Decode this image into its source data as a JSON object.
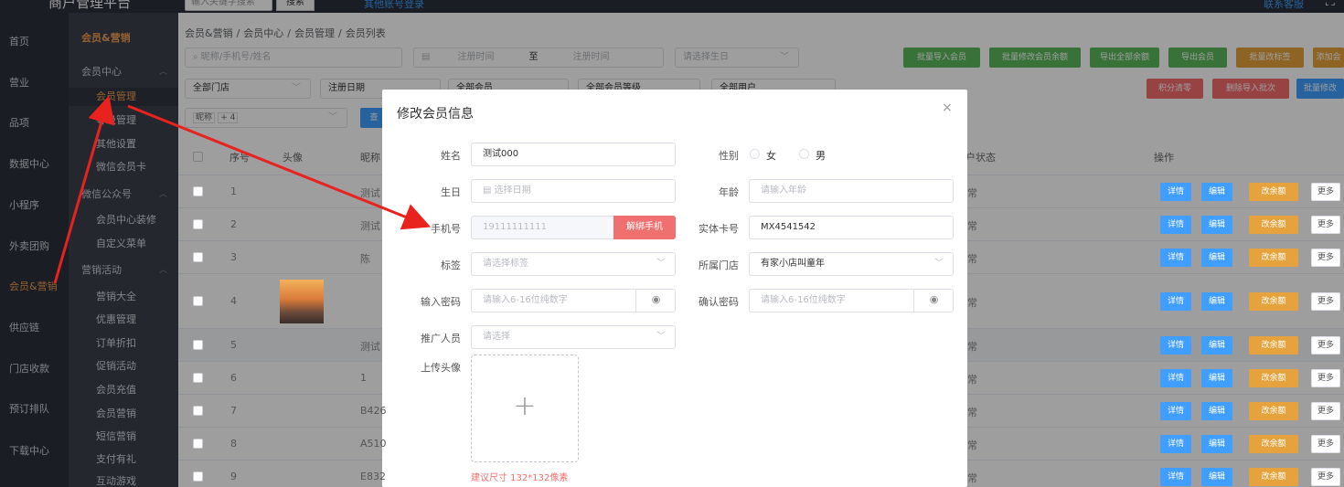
{
  "brand": "商户管理平台",
  "topbar": {
    "search_placeholder": "输入关键字搜索",
    "search_button": "搜索",
    "other_login": "其他账号登录",
    "service": "联系客服",
    "fullscreen_icon": "expand-icon"
  },
  "leftnav": [
    {
      "label": "首页"
    },
    {
      "label": "营业"
    },
    {
      "label": "品项"
    },
    {
      "label": "数据中心"
    },
    {
      "label": "小程序"
    },
    {
      "label": "外卖团购"
    },
    {
      "label": "会员&营销"
    },
    {
      "label": "供应链"
    },
    {
      "label": "门店收款"
    },
    {
      "label": "预订排队"
    },
    {
      "label": "下载中心"
    }
  ],
  "subnav": {
    "title": "会员&营销",
    "items": [
      {
        "label": "会员中心",
        "kind": "group"
      },
      {
        "label": "会员管理",
        "kind": "link"
      },
      {
        "label": "等级管理",
        "kind": "link"
      },
      {
        "label": "其他设置",
        "kind": "link"
      },
      {
        "label": "微信会员卡",
        "kind": "link"
      },
      {
        "label": "微信公众号",
        "kind": "group"
      },
      {
        "label": "会员中心装修",
        "kind": "link"
      },
      {
        "label": "自定义菜单",
        "kind": "link"
      },
      {
        "label": "营销活动",
        "kind": "group"
      },
      {
        "label": "营销大全",
        "kind": "link"
      },
      {
        "label": "优惠管理",
        "kind": "link"
      },
      {
        "label": "订单折扣",
        "kind": "link"
      },
      {
        "label": "促销活动",
        "kind": "link"
      },
      {
        "label": "会员充值",
        "kind": "link"
      },
      {
        "label": "会员营销",
        "kind": "link"
      },
      {
        "label": "短信营销",
        "kind": "link"
      },
      {
        "label": "支付有礼",
        "kind": "link"
      },
      {
        "label": "互动游戏",
        "kind": "link"
      }
    ]
  },
  "breadcrumb": [
    "会员&营销",
    "/",
    "会员中心",
    "/",
    "会员管理",
    "/",
    "会员列表"
  ],
  "filters": {
    "keyword_placeholder": "昵称/手机号/姓名",
    "reg_start": "注册时间",
    "to": "至",
    "reg_end": "注册时间",
    "birthday": "请选择生日",
    "store": "全部门店",
    "reg_date": "注册日期",
    "member": "全部会员",
    "level": "全部会员等级",
    "user": "全部用户",
    "nickname_tag": "昵称",
    "count_tag": "+ 4",
    "query_btn": "查"
  },
  "actions_row1": [
    "批量导入会员",
    "批量修改会员余额",
    "导出全部余额",
    "导出会员",
    "批量改标签",
    "添加会"
  ],
  "actions_row2": [
    "积分清零",
    "删除导入批次",
    "批量修改"
  ],
  "table": {
    "headers": [
      "序号",
      "头像",
      "昵称",
      "户状态",
      "操作"
    ],
    "rows": [
      {
        "no": "1",
        "nick": "测试",
        "status": "常"
      },
      {
        "no": "2",
        "nick": "测试",
        "status": "常"
      },
      {
        "no": "3",
        "nick": "陈",
        "status": "常"
      },
      {
        "no": "4",
        "nick": "",
        "status": "常"
      },
      {
        "no": "5",
        "nick": "测试",
        "status": "常"
      },
      {
        "no": "6",
        "nick": "1",
        "status": "常"
      },
      {
        "no": "7",
        "nick": "B426",
        "status": "常"
      },
      {
        "no": "8",
        "nick": "A510",
        "status": "常"
      },
      {
        "no": "9",
        "nick": "E832",
        "status": "常"
      }
    ],
    "row_actions": [
      "详情",
      "编辑",
      "改余额",
      "更多"
    ]
  },
  "modal": {
    "title": "修改会员信息",
    "close": "×",
    "name_label": "姓名",
    "name_value": "测试000",
    "gender_label": "性别",
    "gender_female": "女",
    "gender_male": "男",
    "birthday_label": "生日",
    "birthday_placeholder": "选择日期",
    "age_label": "年龄",
    "age_placeholder": "请输入年龄",
    "phone_label": "手机号",
    "phone_value": "19111111111",
    "unbind_button": "解绑手机",
    "card_label": "实体卡号",
    "card_value": "MX4541542",
    "tag_label": "标签",
    "tag_placeholder": "请选择标签",
    "store_label": "所属门店",
    "store_value": "有家小店叫童年",
    "pwd_label": "输入密码",
    "pwd_placeholder": "请输入6-16位纯数字",
    "pwd2_label": "确认密码",
    "pwd2_placeholder": "请输入6-16位纯数字",
    "promoter_label": "推广人员",
    "promoter_placeholder": "请选择",
    "avatar_label": "上传头像",
    "avatar_tip": "建议尺寸 132*132像素"
  },
  "colors": {
    "accent": "#409eff",
    "sidebar": "#2b2f3a",
    "highlight": "#f0a050",
    "arrow": "#e8231e"
  }
}
